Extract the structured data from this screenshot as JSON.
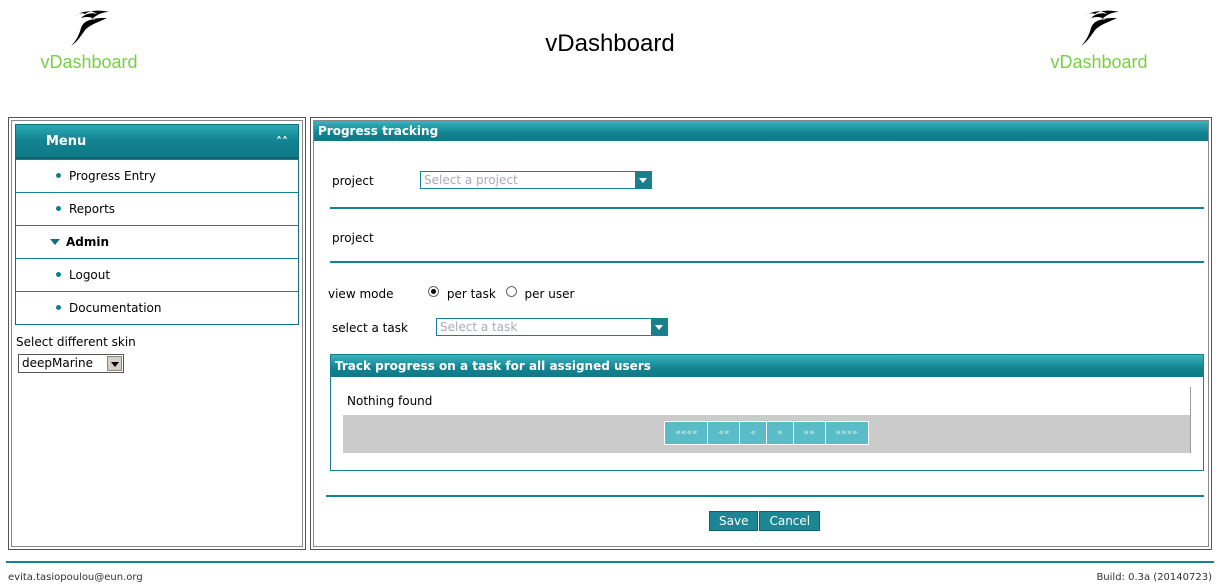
{
  "header": {
    "title": "vDashboard",
    "logo_text": "vDashboard"
  },
  "menu": {
    "title": "Menu",
    "collapse_icon": "double-chevron-up-icon",
    "items": [
      {
        "label": "Progress Entry"
      },
      {
        "label": "Reports"
      },
      {
        "label": "Admin"
      },
      {
        "label": "Logout"
      },
      {
        "label": "Documentation"
      }
    ]
  },
  "skin": {
    "label": "Select different skin",
    "selected": "deepMarine"
  },
  "progress": {
    "title": "Progress tracking",
    "project_label": "project",
    "project_placeholder": "Select a project",
    "project_label2": "project",
    "view_mode_label": "view mode",
    "per_task": "per task",
    "per_user": "per user",
    "select_task_label": "select a task",
    "task_placeholder": "Select a task",
    "track_title": "Track progress on a task for all assigned users",
    "nothing_found": "Nothing found",
    "pager": [
      "««««",
      "««",
      "«",
      "»",
      "»»",
      "»»»»"
    ],
    "save": "Save",
    "cancel": "Cancel"
  },
  "footer": {
    "email": "evita.tasiopoulou@eun.org",
    "build": "Build: 0.3a (20140723)"
  },
  "colors": {
    "accent": "#138391",
    "logo_green": "#77d142"
  }
}
